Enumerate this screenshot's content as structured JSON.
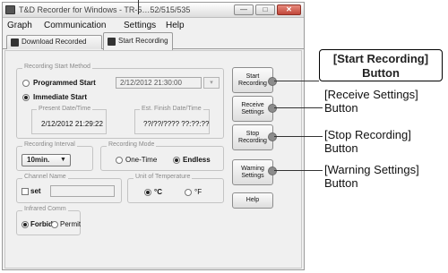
{
  "window": {
    "title": "T&D Recorder for Windows - TR-5…52/515/535",
    "controls": {
      "minimize": "—",
      "maximize": "□",
      "close": "✕"
    }
  },
  "menu": {
    "items": [
      "Graph",
      "Communication",
      "Settings",
      "Help"
    ]
  },
  "tabs": [
    {
      "label": "Download Recorded Data",
      "active": false
    },
    {
      "label": "Start Recording",
      "active": true
    }
  ],
  "start_method": {
    "title": "Recording Start Method",
    "programmed_label": "Programmed Start",
    "programmed_value": "2/12/2012 21:30:00",
    "immediate_label": "Immediate Start",
    "selected": "immediate",
    "present_title": "Present Date/Time",
    "present_value": "2/12/2012  21:29:22",
    "finish_title": "Est. Finish Date/Time",
    "finish_value": "??/??/????   ??:??:??"
  },
  "interval": {
    "title": "Recording Interval",
    "value": "10min."
  },
  "mode": {
    "title": "Recording Mode",
    "one_time": "One-Time",
    "endless": "Endless",
    "selected": "endless"
  },
  "channel": {
    "title": "Channel Name",
    "set_label": "set",
    "value": ""
  },
  "temperature_unit": {
    "title": "Unit of Temperature",
    "c": "°C",
    "f": "°F",
    "selected": "c"
  },
  "infrared": {
    "title": "Infrared Comm",
    "forbid": "Forbid",
    "permit": "Permit",
    "selected": "forbid"
  },
  "buttons": {
    "start": "Start Recording",
    "receive": "Receive Settings",
    "stop": "Stop Recording",
    "warning": "Warning Settings",
    "help": "Help"
  },
  "callouts": {
    "start": "[Start Recording] Button",
    "receive": "[Receive Settings] Button",
    "stop": "[Stop Recording] Button",
    "warning": "[Warning Settings] Button"
  }
}
